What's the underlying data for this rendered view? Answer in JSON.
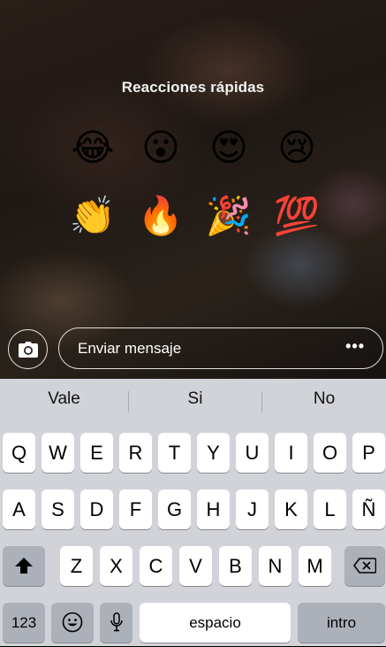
{
  "reactions": {
    "title": "Reacciones rápidas",
    "emojis": [
      "😂",
      "😮",
      "😍",
      "😢",
      "👏",
      "🔥",
      "🎉",
      "💯"
    ]
  },
  "composer": {
    "placeholder": "Enviar mensaje",
    "more": "•••",
    "camera_icon": "camera-icon"
  },
  "suggestions": [
    "Vale",
    "Si",
    "No"
  ],
  "keyboard": {
    "row1": [
      "Q",
      "W",
      "E",
      "R",
      "T",
      "Y",
      "U",
      "I",
      "O",
      "P"
    ],
    "row2": [
      "A",
      "S",
      "D",
      "F",
      "G",
      "H",
      "J",
      "K",
      "L",
      "Ñ"
    ],
    "row3": [
      "Z",
      "X",
      "C",
      "V",
      "B",
      "N",
      "M"
    ],
    "numbers": "123",
    "space": "espacio",
    "return": "intro",
    "emoji_key": "😀"
  }
}
